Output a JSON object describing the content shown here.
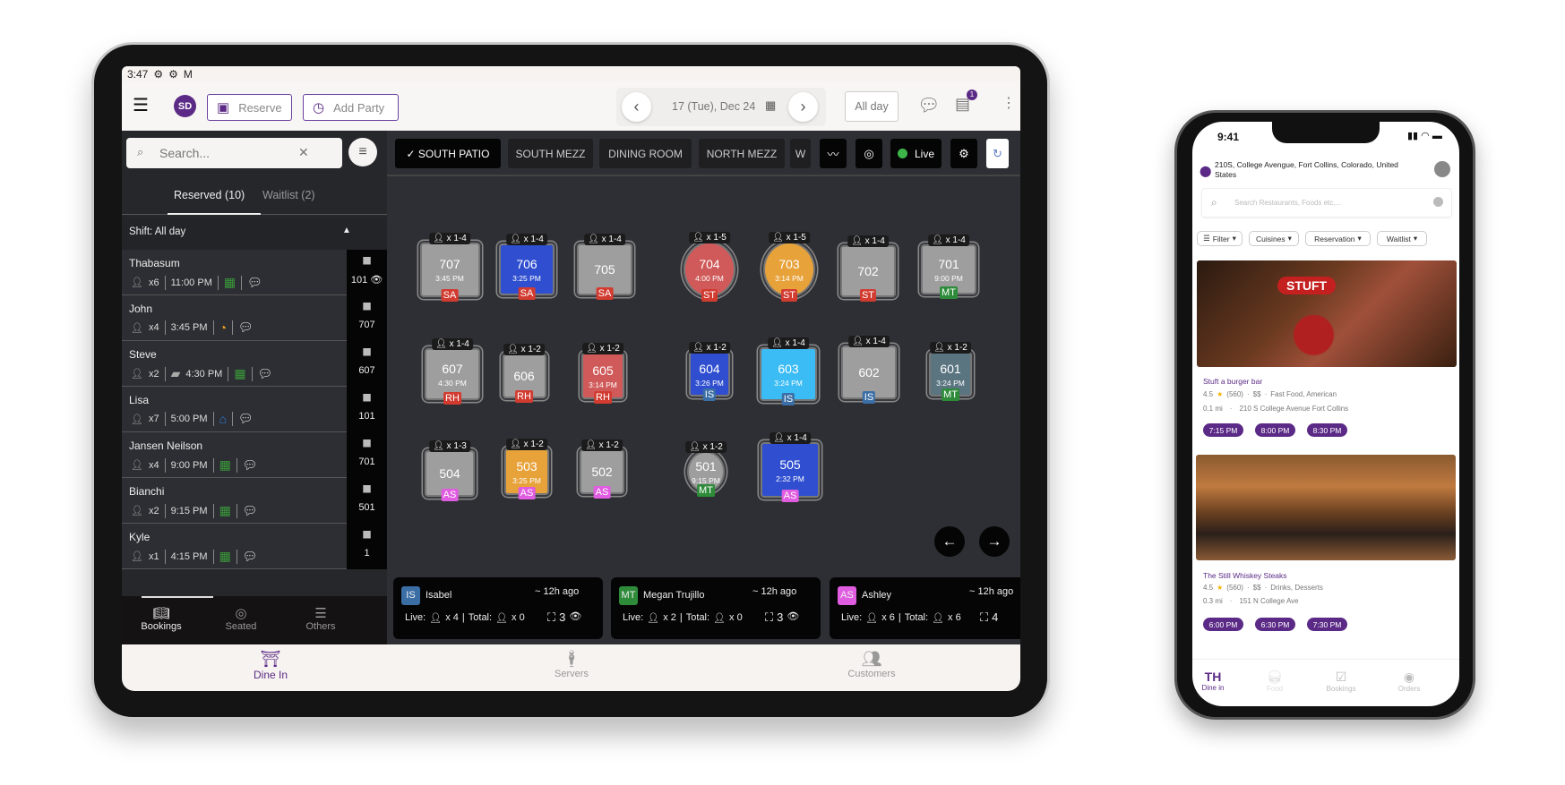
{
  "tablet": {
    "status_bar": {
      "time": "3:47"
    },
    "header": {
      "reserve_label": "Reserve",
      "add_party_label": "Add Party",
      "date": "17 (Tue), Dec 24",
      "shift_select": "All day",
      "notes_badge": "1",
      "accent": "#5b2a86"
    },
    "left_panel": {
      "search_placeholder": "Search...",
      "tabs": [
        {
          "label": "Reserved (10)",
          "active": true
        },
        {
          "label": "Waitlist (2)",
          "active": false
        }
      ],
      "shift_label": "Shift: All day",
      "reservations": [
        {
          "name": "Thabasum",
          "party": "x6",
          "time": "11:00 PM",
          "status_icon": "calendar-check-icon",
          "table": "101",
          "viewed": true
        },
        {
          "name": "John",
          "party": "x4",
          "time": "3:45 PM",
          "status_icon": "clock-icon",
          "table": "707"
        },
        {
          "name": "Steve",
          "party": "x2",
          "time": "4:30 PM",
          "status_icon": "calendar-check-icon",
          "note_icon": "document-icon",
          "table": "607"
        },
        {
          "name": "Lisa",
          "party": "x7",
          "time": "5:00 PM",
          "status_icon": "home-icon",
          "table": "101"
        },
        {
          "name": "Jansen Neilson",
          "party": "x4",
          "time": "9:00 PM",
          "status_icon": "calendar-check-icon",
          "table": "701"
        },
        {
          "name": "Bianchi",
          "party": "x2",
          "time": "9:15 PM",
          "status_icon": "calendar-check-icon",
          "table": "501"
        },
        {
          "name": "Kyle",
          "party": "x1",
          "time": "4:15 PM",
          "status_icon": "calendar-check-icon",
          "table": "1"
        }
      ],
      "bottom_tabs": [
        {
          "label": "Bookings",
          "active": true
        },
        {
          "label": "Seated"
        },
        {
          "label": "Others"
        }
      ]
    },
    "zones": [
      {
        "label": "SOUTH PATIO",
        "active": true
      },
      {
        "label": "SOUTH MEZZ"
      },
      {
        "label": "DINING ROOM"
      },
      {
        "label": "NORTH MEZZ"
      },
      {
        "label": "W"
      }
    ],
    "live_label": "Live",
    "live_color": "#3db54a",
    "tables": [
      {
        "number": "707",
        "time": "3:45 PM",
        "capacity": "x 1-4",
        "server": "SA",
        "color": "#9e9e9e"
      },
      {
        "number": "706",
        "time": "3:25 PM",
        "capacity": "x 1-4",
        "server": "SA",
        "color": "#2f4fd0"
      },
      {
        "number": "705",
        "time": "",
        "capacity": "x 1-4",
        "server": "SA",
        "color": "#9e9e9e"
      },
      {
        "number": "704",
        "time": "4:00 PM",
        "capacity": "x 1-5",
        "server": "ST",
        "color": "#d05a5a",
        "shape": "round"
      },
      {
        "number": "703",
        "time": "3:14 PM",
        "capacity": "x 1-5",
        "server": "ST",
        "color": "#e8a23a",
        "shape": "round"
      },
      {
        "number": "702",
        "time": "",
        "capacity": "x 1-4",
        "server": "ST",
        "color": "#9e9e9e"
      },
      {
        "number": "701",
        "time": "9:00 PM",
        "capacity": "x 1-4",
        "server": "MT",
        "color": "#9e9e9e"
      },
      {
        "number": "607",
        "time": "4:30 PM",
        "capacity": "x 1-4",
        "server": "RH",
        "color": "#9e9e9e"
      },
      {
        "number": "606",
        "time": "",
        "capacity": "x 1-2",
        "server": "RH",
        "color": "#9e9e9e"
      },
      {
        "number": "605",
        "time": "3:14 PM",
        "capacity": "x 1-2",
        "server": "RH",
        "color": "#d05a5a"
      },
      {
        "number": "604",
        "time": "3:26 PM",
        "capacity": "x 1-2",
        "server": "IS",
        "color": "#2f4fd0"
      },
      {
        "number": "603",
        "time": "3:24 PM",
        "capacity": "x 1-4",
        "server": "IS",
        "color": "#3bbcf5"
      },
      {
        "number": "602",
        "time": "",
        "capacity": "x 1-4",
        "server": "IS",
        "color": "#9e9e9e"
      },
      {
        "number": "601",
        "time": "3:24 PM",
        "capacity": "x 1-2",
        "server": "MT",
        "color": "#5a7480"
      },
      {
        "number": "504",
        "time": "",
        "capacity": "x 1-3",
        "server": "AS",
        "color": "#9e9e9e"
      },
      {
        "number": "503",
        "time": "3:25 PM",
        "capacity": "x 1-2",
        "server": "AS",
        "color": "#e8a23a"
      },
      {
        "number": "502",
        "time": "",
        "capacity": "x 1-2",
        "server": "AS",
        "color": "#9e9e9e"
      },
      {
        "number": "501",
        "time": "9:15 PM",
        "capacity": "x 1-2",
        "server": "MT",
        "color": "#9e9e9e",
        "shape": "round"
      },
      {
        "number": "505",
        "time": "2:32 PM",
        "capacity": "x 1-4",
        "server": "AS",
        "color": "#2f4fd0"
      }
    ],
    "server_colors": {
      "SA": "#d23b30",
      "ST": "#d23b30",
      "RH": "#d23b30",
      "MT": "#2e8b3a",
      "IS": "#3a6ea5",
      "AS": "#e05ce0"
    },
    "server_cards": [
      {
        "initials": "IS",
        "name": "Isabel",
        "ago": "~ 12h ago",
        "live_label": "Live:",
        "live": "x 4",
        "total_label": "Total:",
        "total": "x 0",
        "tables": "3"
      },
      {
        "initials": "MT",
        "name": "Megan Trujillo",
        "ago": "~ 12h ago",
        "live_label": "Live:",
        "live": "x 2",
        "total_label": "Total:",
        "total": "x 0",
        "tables": "3"
      },
      {
        "initials": "AS",
        "name": "Ashley",
        "ago": "~ 12h ago",
        "live_label": "Live:",
        "live": "x 6",
        "total_label": "Total:",
        "total": "x 6",
        "tables": "4"
      }
    ],
    "bottom_nav": [
      {
        "label": "Dine In",
        "active": true
      },
      {
        "label": "Servers"
      },
      {
        "label": "Customers"
      }
    ]
  },
  "phone": {
    "status_time": "9:41",
    "location": "210S, College Avengue, Fort Collins, Colorado, United States",
    "search_placeholder": "Search Restaurants, Foods etc,...",
    "filters": [
      "Filter",
      "Cuisines",
      "Reservation",
      "Waitlist"
    ],
    "restaurants": [
      {
        "name": "Stuft a burger bar",
        "rating": "4.5",
        "reviews": "(560)",
        "price": "$$",
        "cuisine": "Fast Food, American",
        "distance": "0.1 mi",
        "address": "210 S College Avenue Fort Collins",
        "times": [
          "7:15 PM",
          "8:00 PM",
          "8:30 PM"
        ],
        "sign_text": "STUFT"
      },
      {
        "name": "The Still Whiskey Steaks",
        "rating": "4.5",
        "reviews": "(560)",
        "price": "$$",
        "cuisine": "Drinks, Desserts",
        "distance": "0.3 mi",
        "address": "151 N College Ave",
        "times": [
          "6:00 PM",
          "6:30 PM",
          "7:30 PM"
        ]
      }
    ],
    "nav": [
      {
        "label": "Dine in",
        "active": true
      },
      {
        "label": "Food"
      },
      {
        "label": "Bookings"
      },
      {
        "label": "Orders"
      }
    ]
  }
}
